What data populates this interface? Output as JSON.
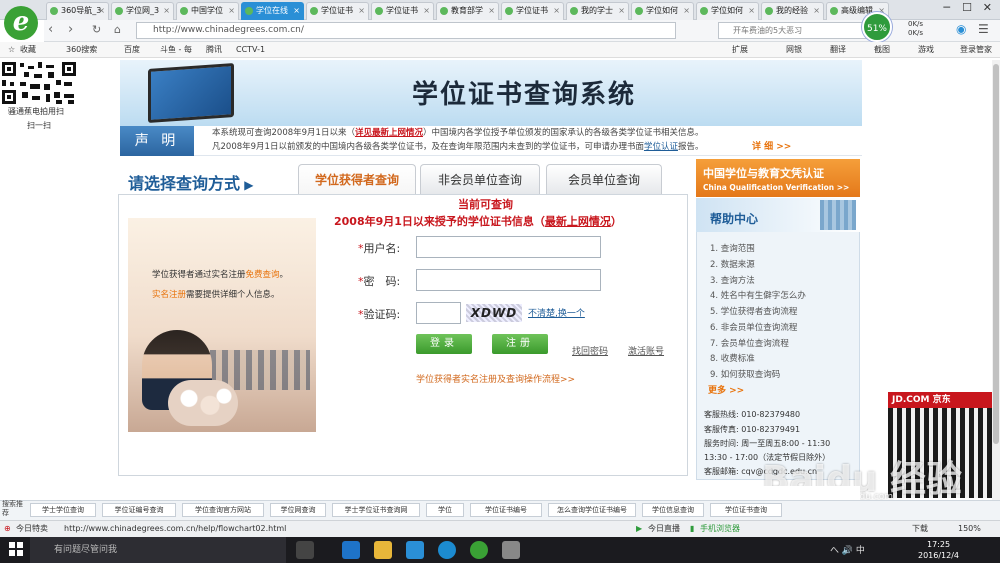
{
  "browser": {
    "tabs": [
      {
        "label": "360导航_3",
        "active": false
      },
      {
        "label": "学位网_3",
        "active": false
      },
      {
        "label": "中国学位",
        "active": false
      },
      {
        "label": "学位在线",
        "active": true
      },
      {
        "label": "学位证书",
        "active": false
      },
      {
        "label": "学位证书",
        "active": false
      },
      {
        "label": "教育部学",
        "active": false
      },
      {
        "label": "学位证书",
        "active": false
      },
      {
        "label": "我的学士",
        "active": false
      },
      {
        "label": "学位如何",
        "active": false
      },
      {
        "label": "学位如何",
        "active": false
      },
      {
        "label": "我的经验",
        "active": false
      },
      {
        "label": "高级编辑",
        "active": false
      }
    ],
    "url": "http://www.chinadegrees.com.cn/",
    "search_placeholder": "开车费油的5大恶习",
    "gauge": "51%",
    "net_up": "0K/s",
    "net_down": "0K/s",
    "toolbar_right": [
      "扩展",
      "网银",
      "翻译",
      "截图",
      "游戏",
      "登录管家"
    ],
    "bookmarks": [
      "收藏",
      "360搜索",
      "百度",
      "斗鱼 - 每",
      "腾讯",
      "CCTV-1"
    ]
  },
  "qr": {
    "line1": "骚通蕉电拍用扫",
    "line2": "扫一扫"
  },
  "page": {
    "title": "学位证书查询系统",
    "decl_label": "声 明",
    "decl_line1_a": "本系统现可查询2008年9月1日以来（",
    "decl_line1_link": "详见最新上网情况",
    "decl_line1_b": "）中国境内各学位授予单位颁发的国家承认的各级各类学位证书相关信息。",
    "decl_line2_a": "凡2008年9月1日以前颁发的中国境内各级各类学位证书，及在查询年限范围内未查到的学位证书，可申请办理书面",
    "decl_line2_link": "学位认证",
    "decl_line2_b": "报告。",
    "detail": "详  细 >>",
    "choose": "请选择查询方式",
    "tabs": [
      "学位获得者查询",
      "非会员单位查询",
      "会员单位查询"
    ],
    "current1": "当前可查询",
    "current2_a": "2008年9月1日以来授予的学位证书信息（",
    "current2_link": "最新上网情况",
    "current2_b": "）",
    "illus_line1_a": "学位获得者通过实名注册",
    "illus_line1_b": "免费查询",
    "illus_line1_c": "。",
    "illus_line2_a": "实名注册",
    "illus_line2_b": "需要提供详细个人信息。",
    "form": {
      "username_label": "用户名:",
      "password_label": "密　码:",
      "captcha_label": "验证码:",
      "star": "*",
      "captcha_text": "XDWD",
      "refresh": "不清楚,换一个",
      "login": "登录",
      "register": "注册",
      "find_password": "找回密码",
      "activate": "激活账号"
    },
    "flow_link": "学位获得者实名注册及查询操作流程>>",
    "cn_banner_cn": "中国学位与教育文凭认证",
    "cn_banner_en": "China Qualification Verification >>",
    "help_title": "帮助中心",
    "help_items": [
      "1. 查询范围",
      "2. 数据来源",
      "3. 查询方法",
      "4. 姓名中有生僻字怎么办",
      "5. 学位获得者查询流程",
      "6. 非会员单位查询流程",
      "7. 会员单位查询流程",
      "8. 收费标准",
      "9. 如何获取查询码"
    ],
    "more": "更多 >>",
    "contact": [
      "客服热线: 010-82379480",
      "客服传真: 010-82379491",
      "服务时间: 周一至周五8:00 - 11:30",
      "13:30 - 17:00（法定节假日除外）",
      "客服邮箱: cqv@cdgdc.edu.cn"
    ]
  },
  "ad": {
    "head": "JD.COM 京东"
  },
  "watermark": {
    "main": "Baidu 经验",
    "sub": "jingyan.baidu.com"
  },
  "recbar": {
    "title": "搜索推荐",
    "items": [
      "学士学位查询",
      "学位证编号查询",
      "学位查询官方网站",
      "学位网查询",
      "学士学位证书查询网",
      "学位",
      "学位证书编号",
      "怎么查询学位证书编号",
      "学位信息查询",
      "学位证书查询"
    ]
  },
  "status": {
    "feature": "今日特卖",
    "url": "http://www.chinadegrees.com.cn/help/flowchart02.html",
    "live": "今日直播",
    "phone": "手机浏览器",
    "download": "下载",
    "zoom": "150%"
  },
  "taskbar": {
    "search": "有问题尽管问我",
    "tray": "へ 🔊 中",
    "time": "17:25",
    "date": "2016/12/4"
  }
}
